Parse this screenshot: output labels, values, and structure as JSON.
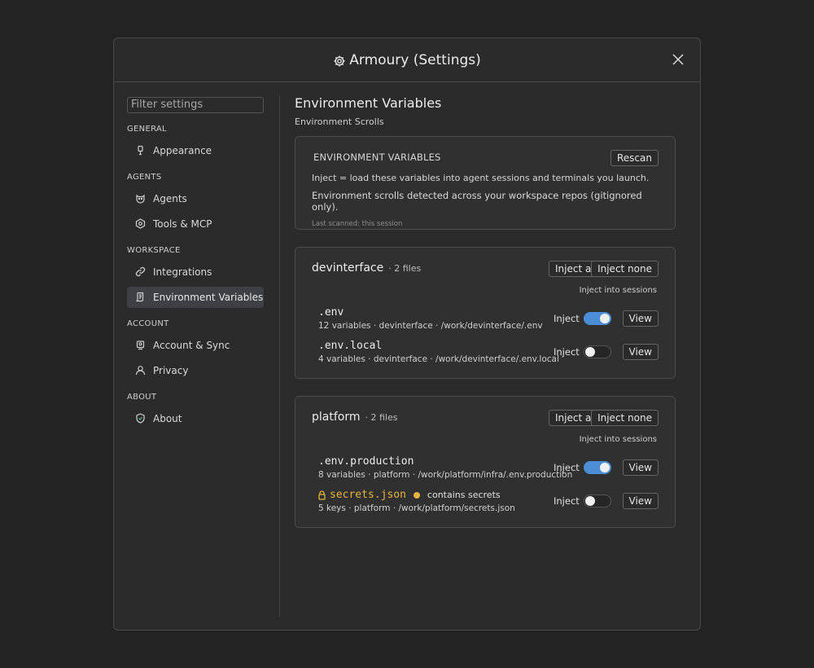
{
  "dialog": {
    "title": "Armoury (Settings)"
  },
  "sidebar": {
    "filter_placeholder": "Filter settings",
    "groups": [
      {
        "label": "GENERAL",
        "items": [
          {
            "label": "Appearance",
            "icon": "brush-icon"
          }
        ]
      },
      {
        "label": "AGENTS",
        "items": [
          {
            "label": "Agents",
            "icon": "agent-icon"
          },
          {
            "label": "Tools & MCP",
            "icon": "tools-icon"
          }
        ]
      },
      {
        "label": "WORKSPACE",
        "items": [
          {
            "label": "Integrations",
            "icon": "link-icon"
          },
          {
            "label": "Environment Variables",
            "icon": "scroll-icon",
            "active": true
          }
        ]
      },
      {
        "label": "ACCOUNT",
        "items": [
          {
            "label": "Account & Sync",
            "icon": "account-icon"
          },
          {
            "label": "Privacy",
            "icon": "user-icon"
          }
        ]
      },
      {
        "label": "ABOUT",
        "items": [
          {
            "label": "About",
            "icon": "shield-icon"
          }
        ]
      }
    ]
  },
  "main": {
    "title": "Environment Variables",
    "subtitle": "Environment Scrolls",
    "info": {
      "heading": "ENVIRONMENT VARIABLES",
      "rescan_label": "Rescan",
      "line1": "Inject = load these variables into agent sessions and terminals you launch.",
      "line2": "Environment scrolls detected across your workspace repos (gitignored only).",
      "line3": "Last scanned: this session"
    },
    "inject_label": "Inject",
    "view_label": "View",
    "inject_all_label": "Inject all",
    "inject_none_label": "Inject none",
    "inject_into_label": "Inject into sessions",
    "repos": [
      {
        "name": "devinterface",
        "count": "· 2 files",
        "files": [
          {
            "name": ".env",
            "meta": "12 variables · devinterface · /work/devinterface/.env",
            "inject": true
          },
          {
            "name": ".env.local",
            "meta": "4 variables · devinterface · /work/devinterface/.env.local",
            "inject": false
          }
        ]
      },
      {
        "name": "platform",
        "count": "· 2 files",
        "files": [
          {
            "name": ".env.production",
            "meta": "8 variables · platform · /work/platform/infra/.env.production",
            "inject": true
          },
          {
            "name": "secrets.json",
            "meta": "5 keys · platform · /work/platform/secrets.json",
            "inject": false,
            "secret": true,
            "secret_note": "contains secrets"
          }
        ]
      }
    ]
  },
  "colors": {
    "accent": "#4c8ed6",
    "secret": "#e8b43e",
    "background": "#232323",
    "panel": "#2b2b2b"
  }
}
